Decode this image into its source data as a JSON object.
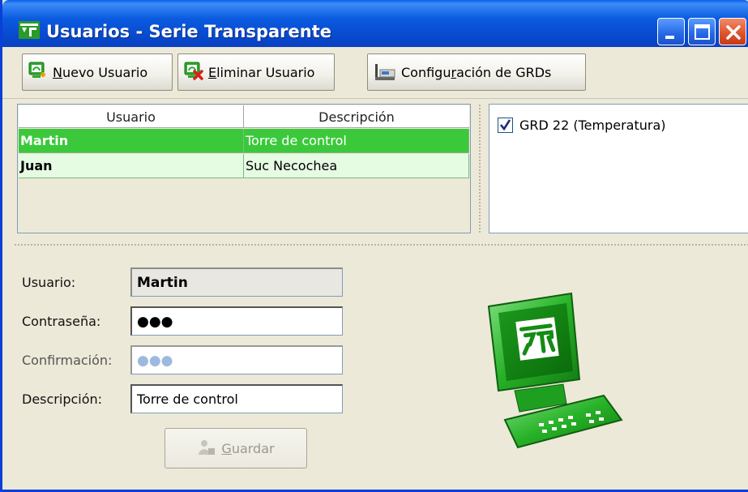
{
  "window": {
    "title": "Usuarios - Serie Transparente",
    "icon": "app-logo-icon"
  },
  "toolbar": {
    "nuevo_prefix": "",
    "nuevo_accel": "N",
    "nuevo_rest": "uevo Usuario",
    "eliminar_accel": "E",
    "eliminar_rest": "liminar Usuario",
    "config_pre": "Configu",
    "config_accel": "r",
    "config_rest": "ación de GRDs"
  },
  "table": {
    "headers": [
      "Usuario",
      "Descripción"
    ],
    "rows": [
      {
        "usuario": "Martin",
        "descripcion": "Torre de control",
        "selected": true
      },
      {
        "usuario": "Juan",
        "descripcion": "Suc Necochea",
        "selected": false
      }
    ]
  },
  "grd_list": {
    "items": [
      {
        "label": "GRD 22 (Temperatura)",
        "checked": true
      }
    ]
  },
  "form": {
    "usuario_label": "Usuario:",
    "usuario_value": "Martin",
    "password_label": "Contraseña:",
    "password_value": "●●●",
    "confirm_label": "Confirmación:",
    "confirm_value": "●●●",
    "descripcion_label": "Descripción:",
    "descripcion_value": "Torre de control",
    "guardar_accel": "G",
    "guardar_rest": "uardar"
  },
  "colors": {
    "selected_row": "#3bc93b",
    "normal_row": "#e5fbe2",
    "titlebar": "#0a5ae0",
    "logo_green": "#2fb52f"
  }
}
